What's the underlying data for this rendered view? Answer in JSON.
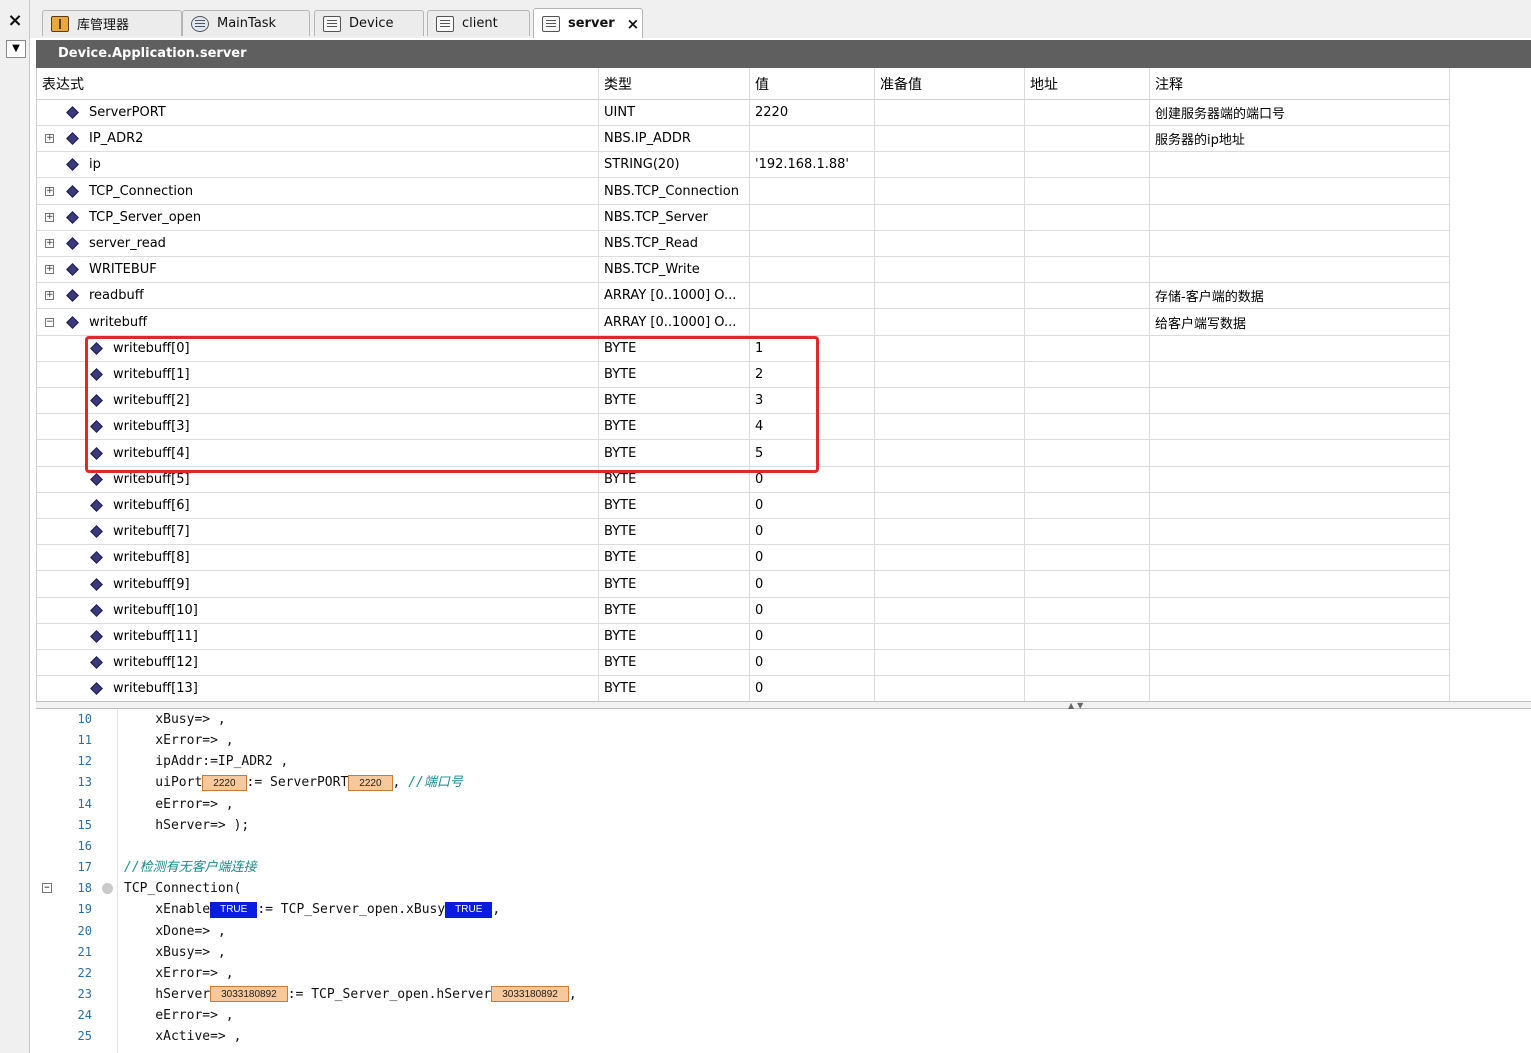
{
  "tabs": [
    {
      "label": "库管理器",
      "icon": "library-icon"
    },
    {
      "label": "MainTask",
      "icon": "task-icon"
    },
    {
      "label": "Device",
      "icon": "device-icon"
    },
    {
      "label": "client",
      "icon": "document-icon"
    },
    {
      "label": "server",
      "icon": "document-icon",
      "active": true
    }
  ],
  "close_tab_glyph": "×",
  "title": "Device.Application.server",
  "columns": [
    "表达式",
    "类型",
    "值",
    "准备值",
    "地址",
    "注释"
  ],
  "rows": [
    {
      "expr": "ServerPORT",
      "type": "UINT",
      "value": "2220",
      "prepared": "",
      "address": "",
      "comment": "创建服务器端的端口号"
    },
    {
      "expr": "IP_ADR2",
      "type": "NBS.IP_ADDR",
      "value": "",
      "prepared": "",
      "address": "",
      "comment": "服务器的ip地址"
    },
    {
      "expr": "ip",
      "type": "STRING(20)",
      "value": "'192.168.1.88'",
      "prepared": "",
      "address": "",
      "comment": ""
    },
    {
      "expr": "TCP_Connection",
      "type": "NBS.TCP_Connection",
      "value": "",
      "prepared": "",
      "address": "",
      "comment": ""
    },
    {
      "expr": "TCP_Server_open",
      "type": "NBS.TCP_Server",
      "value": "",
      "prepared": "",
      "address": "",
      "comment": ""
    },
    {
      "expr": "server_read",
      "type": "NBS.TCP_Read",
      "value": "",
      "prepared": "",
      "address": "",
      "comment": ""
    },
    {
      "expr": "WRITEBUF",
      "type": "NBS.TCP_Write",
      "value": "",
      "prepared": "",
      "address": "",
      "comment": ""
    },
    {
      "expr": "readbuff",
      "type": "ARRAY [0..1000] O...",
      "value": "",
      "prepared": "",
      "address": "",
      "comment": "存储-客户端的数据"
    },
    {
      "expr": "writebuff",
      "type": "ARRAY [0..1000] O...",
      "value": "",
      "prepared": "",
      "address": "",
      "comment": "给客户端写数据"
    },
    {
      "expr": "writebuff[0]",
      "type": "BYTE",
      "value": "1",
      "prepared": "",
      "address": "",
      "comment": ""
    },
    {
      "expr": "writebuff[1]",
      "type": "BYTE",
      "value": "2",
      "prepared": "",
      "address": "",
      "comment": ""
    },
    {
      "expr": "writebuff[2]",
      "type": "BYTE",
      "value": "3",
      "prepared": "",
      "address": "",
      "comment": ""
    },
    {
      "expr": "writebuff[3]",
      "type": "BYTE",
      "value": "4",
      "prepared": "",
      "address": "",
      "comment": ""
    },
    {
      "expr": "writebuff[4]",
      "type": "BYTE",
      "value": "5",
      "prepared": "",
      "address": "",
      "comment": ""
    },
    {
      "expr": "writebuff[5]",
      "type": "BYTE",
      "value": "0",
      "prepared": "",
      "address": "",
      "comment": ""
    },
    {
      "expr": "writebuff[6]",
      "type": "BYTE",
      "value": "0",
      "prepared": "",
      "address": "",
      "comment": ""
    },
    {
      "expr": "writebuff[7]",
      "type": "BYTE",
      "value": "0",
      "prepared": "",
      "address": "",
      "comment": ""
    },
    {
      "expr": "writebuff[8]",
      "type": "BYTE",
      "value": "0",
      "prepared": "",
      "address": "",
      "comment": ""
    },
    {
      "expr": "writebuff[9]",
      "type": "BYTE",
      "value": "0",
      "prepared": "",
      "address": "",
      "comment": ""
    },
    {
      "expr": "writebuff[10]",
      "type": "BYTE",
      "value": "0",
      "prepared": "",
      "address": "",
      "comment": ""
    },
    {
      "expr": "writebuff[11]",
      "type": "BYTE",
      "value": "0",
      "prepared": "",
      "address": "",
      "comment": ""
    },
    {
      "expr": "writebuff[12]",
      "type": "BYTE",
      "value": "0",
      "prepared": "",
      "address": "",
      "comment": ""
    },
    {
      "expr": "writebuff[13]",
      "type": "BYTE",
      "value": "0",
      "prepared": "",
      "address": "",
      "comment": ""
    }
  ],
  "row_flags": [
    {
      "expander": "",
      "child": false
    },
    {
      "expander": "+",
      "child": false
    },
    {
      "expander": "",
      "child": false
    },
    {
      "expander": "+",
      "child": false
    },
    {
      "expander": "+",
      "child": false
    },
    {
      "expander": "+",
      "child": false
    },
    {
      "expander": "+",
      "child": false
    },
    {
      "expander": "+",
      "child": false
    },
    {
      "expander": "−",
      "child": false
    },
    {
      "expander": "",
      "child": true
    },
    {
      "expander": "",
      "child": true
    },
    {
      "expander": "",
      "child": true
    },
    {
      "expander": "",
      "child": true
    },
    {
      "expander": "",
      "child": true
    },
    {
      "expander": "",
      "child": true
    },
    {
      "expander": "",
      "child": true
    },
    {
      "expander": "",
      "child": true
    },
    {
      "expander": "",
      "child": true
    },
    {
      "expander": "",
      "child": true
    },
    {
      "expander": "",
      "child": true
    },
    {
      "expander": "",
      "child": true
    },
    {
      "expander": "",
      "child": true
    },
    {
      "expander": "",
      "child": true
    }
  ],
  "code_lines": [
    {
      "n": "10",
      "segs": [
        {
          "t": "    xBusy=> ,"
        }
      ]
    },
    {
      "n": "11",
      "segs": [
        {
          "t": "    xError=> ,"
        }
      ]
    },
    {
      "n": "12",
      "segs": [
        {
          "t": "    ipAddr:=IP_ADR2 ,"
        }
      ]
    },
    {
      "n": "13",
      "segs": [
        {
          "t": "    uiPort"
        },
        {
          "v": "2220",
          "k": "num"
        },
        {
          "t": ":= ServerPORT"
        },
        {
          "v": "2220",
          "k": "num"
        },
        {
          "t": ", "
        },
        {
          "c": "//端口号"
        }
      ]
    },
    {
      "n": "14",
      "segs": [
        {
          "t": "    eError=> ,"
        }
      ]
    },
    {
      "n": "15",
      "segs": [
        {
          "t": "    hServer=> );"
        }
      ]
    },
    {
      "n": "16",
      "segs": []
    },
    {
      "n": "17",
      "segs": [
        {
          "c": "//检测有无客户端连接"
        }
      ]
    },
    {
      "n": "18",
      "segs": [
        {
          "t": "TCP_Connection("
        }
      ],
      "fold": "−",
      "bp": true
    },
    {
      "n": "19",
      "segs": [
        {
          "t": "    xEnable"
        },
        {
          "v": "TRUE",
          "k": "bool"
        },
        {
          "t": ":= TCP_Server_open.xBusy"
        },
        {
          "v": "TRUE",
          "k": "bool"
        },
        {
          "t": ","
        }
      ]
    },
    {
      "n": "20",
      "segs": [
        {
          "t": "    xDone=> ,"
        }
      ]
    },
    {
      "n": "21",
      "segs": [
        {
          "t": "    xBusy=> ,"
        }
      ]
    },
    {
      "n": "22",
      "segs": [
        {
          "t": "    xError=> ,"
        }
      ]
    },
    {
      "n": "23",
      "segs": [
        {
          "t": "    hServer"
        },
        {
          "v": "3033180892",
          "k": "num"
        },
        {
          "t": ":= TCP_Server_open.hServer"
        },
        {
          "v": "3033180892",
          "k": "num"
        },
        {
          "t": ","
        }
      ]
    },
    {
      "n": "24",
      "segs": [
        {
          "t": "    eError=> ,"
        }
      ]
    },
    {
      "n": "25",
      "segs": [
        {
          "t": "    xActive=> ,"
        }
      ]
    }
  ]
}
